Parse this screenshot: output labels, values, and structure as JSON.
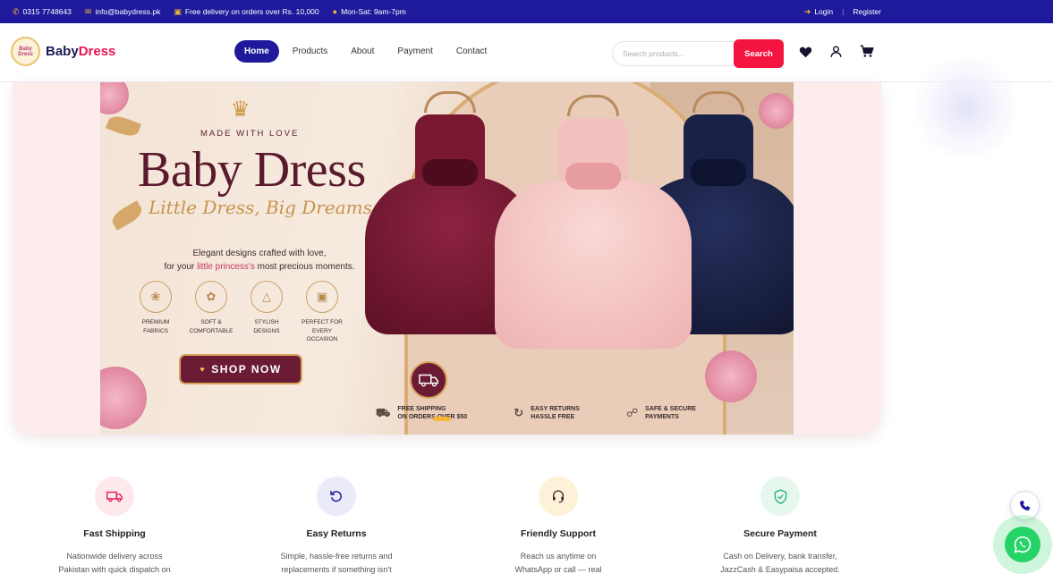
{
  "topbar": {
    "phone": "0315 7748643",
    "email": "info@babydress.pk",
    "delivery": "Free delivery on orders over Rs. 10,000",
    "hours": "Mon-Sat: 9am-7pm",
    "login": "Login",
    "register": "Register",
    "separator": "|"
  },
  "header": {
    "logo_brand_first": "Baby",
    "logo_brand_second": "Dress",
    "logo_badge": "Baby Dress",
    "nav": [
      "Home",
      "Products",
      "About",
      "Payment",
      "Contact"
    ],
    "active_nav": "Home",
    "search_placeholder": "Search products...",
    "search_button": "Search",
    "icons": [
      "heart-icon",
      "user-icon",
      "cart-icon"
    ]
  },
  "hero": {
    "made_with": "MADE WITH LOVE",
    "title": "Baby Dress",
    "tagline": "Little Dress, Big Dreams",
    "desc_line1": "Elegant designs crafted with love,",
    "desc_line2_pre": "for your ",
    "desc_line2_highlight": "little princess's",
    "desc_line2_post": " most precious moments.",
    "features": [
      {
        "l1": "PREMIUM",
        "l2": "FABRICS"
      },
      {
        "l1": "SOFT &",
        "l2": "COMFORTABLE"
      },
      {
        "l1": "STYLISH",
        "l2": "DESIGNS"
      },
      {
        "l1": "PERFECT FOR",
        "l2": "EVERY OCCASION"
      }
    ],
    "shop_now": "SHOP NOW",
    "strip": [
      {
        "l1": "FREE SHIPPING",
        "l2": "ON ORDERS OVER $50"
      },
      {
        "l1": "EASY RETURNS",
        "l2": "HASSLE FREE"
      },
      {
        "l1": "SAFE & SECURE",
        "l2": "PAYMENTS"
      }
    ]
  },
  "features": [
    {
      "title": "Fast Shipping",
      "desc1": "Nationwide delivery across",
      "desc2": "Pakistan with quick dispatch on",
      "color": "#e8154f",
      "bg": "#fde8ec"
    },
    {
      "title": "Easy Returns",
      "desc1": "Simple, hassle-free returns and",
      "desc2": "replacements if something isn't",
      "color": "#1f1a9c",
      "bg": "#ebeaf8"
    },
    {
      "title": "Friendly Support",
      "desc1": "Reach us anytime on",
      "desc2": "WhatsApp or call — real",
      "color": "#3a2b2d",
      "bg": "#fdf1d8"
    },
    {
      "title": "Secure Payment",
      "desc1": "Cash on Delivery, bank transfer,",
      "desc2": "JazzCash & Easypaisa accepted.",
      "color": "#2bb673",
      "bg": "#e6f7ee"
    }
  ],
  "colors": {
    "brand_navy": "#1f1a9c",
    "brand_red": "#f3143f",
    "whatsapp": "#25d366"
  }
}
